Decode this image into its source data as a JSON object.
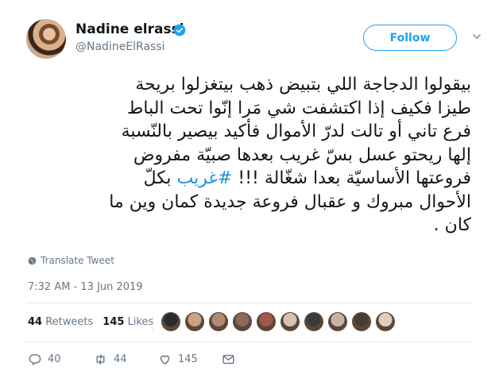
{
  "user": {
    "name": "Nadine elrassi",
    "handle": "@NadineElRassi",
    "verified": true
  },
  "follow_label": "Follow",
  "tweet": {
    "lines": [
      "بيقولوا الدجاجة اللي بتبيض ذهب بيتغزلوا بريحة",
      "طيزا فكيف إذا اكتشفت شي مَرا إنّوا تحت الباط",
      "فرع تاني أو تالت لدرّ الأموال فأكيد بيصير بالنّسبة",
      "إلها ريحتو عسل بسّ غريب بعدها صبيّة مفروض",
      "فروعتها الأساسيّة بعدا شغّالة !!! ",
      "الأحوال مبروك و عقبال فروعة جديدة كمان وين ما",
      "كان ."
    ],
    "hashtag": "#غريب",
    "after_hashtag": " بكلّ"
  },
  "translate_label": "Translate Tweet",
  "timestamp": "7:32 AM - 13 Jun 2019",
  "stats": {
    "retweets_count": "44",
    "retweets_label": "Retweets",
    "likes_count": "145",
    "likes_label": "Likes"
  },
  "liker_colors": [
    "#2b2b2b",
    "#c9a287",
    "#b08a74",
    "#8c6a58",
    "#a1574a",
    "#d9c2b4",
    "#3a3a3a",
    "#c8b2a6",
    "#4b3a33",
    "#e2cdbd"
  ],
  "actions": {
    "replies": "40",
    "retweets": "44",
    "likes": "145"
  },
  "colors": {
    "accent": "#1da1f2",
    "hashtag": "#1b95e0",
    "muted": "#657786"
  }
}
